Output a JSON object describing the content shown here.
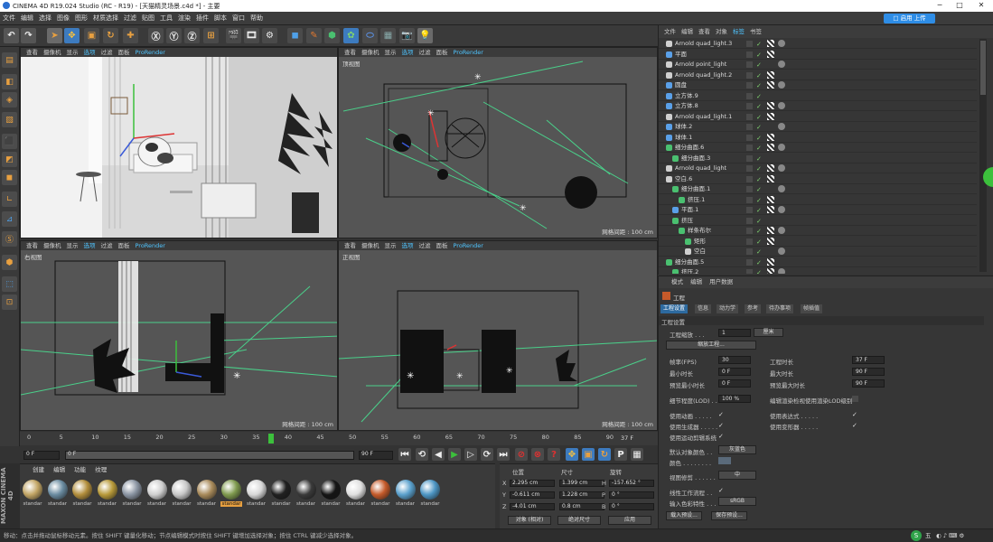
{
  "window": {
    "title": "CINEMA 4D R19.024 Studio (RC - R19) - [天猫精灵场景.c4d *] - 主要",
    "minimize": "─",
    "maximize": "□",
    "close": "✕"
  },
  "menu": {
    "items": [
      "文件",
      "编辑",
      "选择",
      "图像",
      "图形",
      "材质选择",
      "过滤",
      "贴图",
      "工具",
      "渲染",
      "插件",
      "脚本",
      "窗口",
      "帮助"
    ],
    "layout_button": "□ 启用 上传"
  },
  "viewports": [
    {
      "name": "",
      "menu": [
        "查看",
        "摄像机",
        "显示",
        "选项",
        "过滤",
        "面板",
        "ProRender"
      ],
      "grid": ""
    },
    {
      "name": "顶视图",
      "menu": [
        "查看",
        "摄像机",
        "显示",
        "选项",
        "过滤",
        "面板",
        "ProRender"
      ],
      "grid": "网格间距 : 100 cm"
    },
    {
      "name": "右视图",
      "menu": [
        "查看",
        "摄像机",
        "显示",
        "选项",
        "过滤",
        "面板",
        "ProRender"
      ],
      "grid": "网格间距 : 100 cm"
    },
    {
      "name": "正视图",
      "menu": [
        "查看",
        "摄像机",
        "显示",
        "选项",
        "过滤",
        "面板",
        "ProRender"
      ],
      "grid": "网格间距 : 100 cm"
    }
  ],
  "timeline": {
    "ticks": [
      "0",
      "5",
      "10",
      "15",
      "20",
      "25",
      "30",
      "35",
      "40",
      "45",
      "50",
      "55",
      "60",
      "65",
      "70",
      "75",
      "80",
      "85",
      "90"
    ],
    "current_frame": "37",
    "end_display": "37 F",
    "start_field": "0 F",
    "start_field2": "0 F",
    "range_end_left": "90 F",
    "range_end_right": "90 F"
  },
  "materials": {
    "tabs": [
      "创建",
      "编辑",
      "功能",
      "纹理"
    ],
    "items": [
      {
        "label": "standar",
        "color": "#c2a565"
      },
      {
        "label": "standar",
        "color": "#6a8ba0"
      },
      {
        "label": "standar",
        "color": "#b28e3c"
      },
      {
        "label": "standar",
        "color": "#b89a3a"
      },
      {
        "label": "standar",
        "color": "#8b95a3"
      },
      {
        "label": "standar",
        "color": "#cfcfcf"
      },
      {
        "label": "standar",
        "color": "#c8c8c8"
      },
      {
        "label": "standar",
        "color": "#a88a5a"
      },
      {
        "label": "standar",
        "color": "#7f9a4e"
      },
      {
        "label": "standar",
        "color": "#d8d8d8"
      },
      {
        "label": "standar",
        "color": "#202020"
      },
      {
        "label": "standar",
        "color": "#3a3a3a"
      },
      {
        "label": "standar",
        "color": "#151515"
      },
      {
        "label": "standar",
        "color": "#e0e0e0"
      },
      {
        "label": "standar",
        "color": "#c55a2a"
      },
      {
        "label": "standar",
        "color": "#5aa0cc"
      },
      {
        "label": "standar",
        "color": "#4d96c4"
      }
    ],
    "selected_index": 8
  },
  "coords": {
    "headers": [
      "位置",
      "尺寸",
      "旋转"
    ],
    "rows": [
      {
        "axis": "X",
        "pos": "2.295 cm",
        "size": "1.399 cm",
        "rot_axis": "H",
        "rot": "-157.652 °"
      },
      {
        "axis": "Y",
        "pos": "-0.611 cm",
        "size": "1.228 cm",
        "rot_axis": "P",
        "rot": "0 °"
      },
      {
        "axis": "Z",
        "pos": "-4.01 cm",
        "size": "0.8 cm",
        "rot_axis": "B",
        "rot": "0 °"
      }
    ],
    "mode": "对象 (相对)",
    "size_mode": "绝对尺寸",
    "apply": "应用"
  },
  "object_manager": {
    "menu": [
      "文件",
      "编辑",
      "查看",
      "对象",
      "标签",
      "书签"
    ],
    "rows": [
      {
        "name": "Arnold quad_light.3",
        "indent": 0,
        "icon": "light"
      },
      {
        "name": "平面",
        "indent": 0,
        "icon": "plane"
      },
      {
        "name": "Arnold point_light",
        "indent": 0,
        "icon": "light"
      },
      {
        "name": "Arnold quad_light.2",
        "indent": 0,
        "icon": "light"
      },
      {
        "name": "圆盘",
        "indent": 0,
        "icon": "disc"
      },
      {
        "name": "立方体.9",
        "indent": 0,
        "icon": "cube"
      },
      {
        "name": "立方体.8",
        "indent": 0,
        "icon": "cube"
      },
      {
        "name": "Arnold quad_light.1",
        "indent": 0,
        "icon": "light"
      },
      {
        "name": "球体.2",
        "indent": 0,
        "icon": "sphere"
      },
      {
        "name": "球体.1",
        "indent": 0,
        "icon": "sphere"
      },
      {
        "name": "细分曲面.6",
        "indent": 0,
        "icon": "subd"
      },
      {
        "name": "细分曲面.3",
        "indent": 1,
        "icon": "subd"
      },
      {
        "name": "Arnold quad_light",
        "indent": 0,
        "icon": "light"
      },
      {
        "name": "空白.6",
        "indent": 0,
        "icon": "null"
      },
      {
        "name": "细分曲面.1",
        "indent": 1,
        "icon": "subd"
      },
      {
        "name": "挤压.1",
        "indent": 2,
        "icon": "extrude"
      },
      {
        "name": "平面.1",
        "indent": 1,
        "icon": "plane"
      },
      {
        "name": "挤压",
        "indent": 1,
        "icon": "extrude"
      },
      {
        "name": "样条布尔",
        "indent": 2,
        "icon": "spline"
      },
      {
        "name": "矩形",
        "indent": 3,
        "icon": "spline"
      },
      {
        "name": "空白",
        "indent": 3,
        "icon": "null"
      },
      {
        "name": "细分曲面.5",
        "indent": 0,
        "icon": "subd"
      },
      {
        "name": "挤压.2",
        "indent": 1,
        "icon": "extrude"
      }
    ]
  },
  "attributes": {
    "menu": [
      "模式",
      "编辑",
      "用户数据"
    ],
    "object_label": "工程",
    "tabs": [
      "工程设置",
      "信息",
      "动力学",
      "参考",
      "待办事项",
      "帧插值"
    ],
    "section": "工程设置",
    "scale_label": "工程缩放 . . .",
    "scale_value": "1",
    "scale_unit": "厘米",
    "scale_button": "缩放工程...",
    "fps_label": "帧率(FPS)",
    "fps": "30",
    "project_len_label": "工程时长",
    "project_len": "37 F",
    "min_len_label": "最小时长",
    "min_len": "0 F",
    "max_len_label": "最大时长",
    "max_len": "90 F",
    "preview_min_label": "预览最小时长",
    "preview_min": "0 F",
    "preview_max_label": "预览最大时长",
    "preview_max": "90 F",
    "lod_label": "细节程度(LOD) . .",
    "lod": "100 %",
    "lod_render_label": "编辑渲染检视使用渲染LOD级别",
    "anim_label": "使用动画 . . . . .",
    "expr_label": "使用表达式 . . . . .",
    "gen_label": "使用生成器 . . . . .",
    "deform_label": "使用变形器 . . . . .",
    "motion_label": "使用运动剪辑系统",
    "default_color_label": "默认对象颜色 . .",
    "default_color": "灰蓝色",
    "color_label": "颜色 . . . . . . . .",
    "view_clip_label": "视图修剪 . . . . . .",
    "view_clip": "中",
    "linear_label": "线性工作流程 . .",
    "input_color_label": "输入色彩特性 . . .",
    "input_color": "sRGB",
    "load_preset": "载入预设...",
    "save_preset": "保存预设..."
  },
  "status": {
    "text": "移动：点击并拖动鼠标移动元素。按住 SHIFT 键量化移动；节点编辑模式时按住 SHIFT 键增加选择对象；按住 CTRL 键减少选择对象。",
    "ime": "五",
    "tray": "◐ ♪ ⌨ ⚙"
  },
  "chart_data": null
}
